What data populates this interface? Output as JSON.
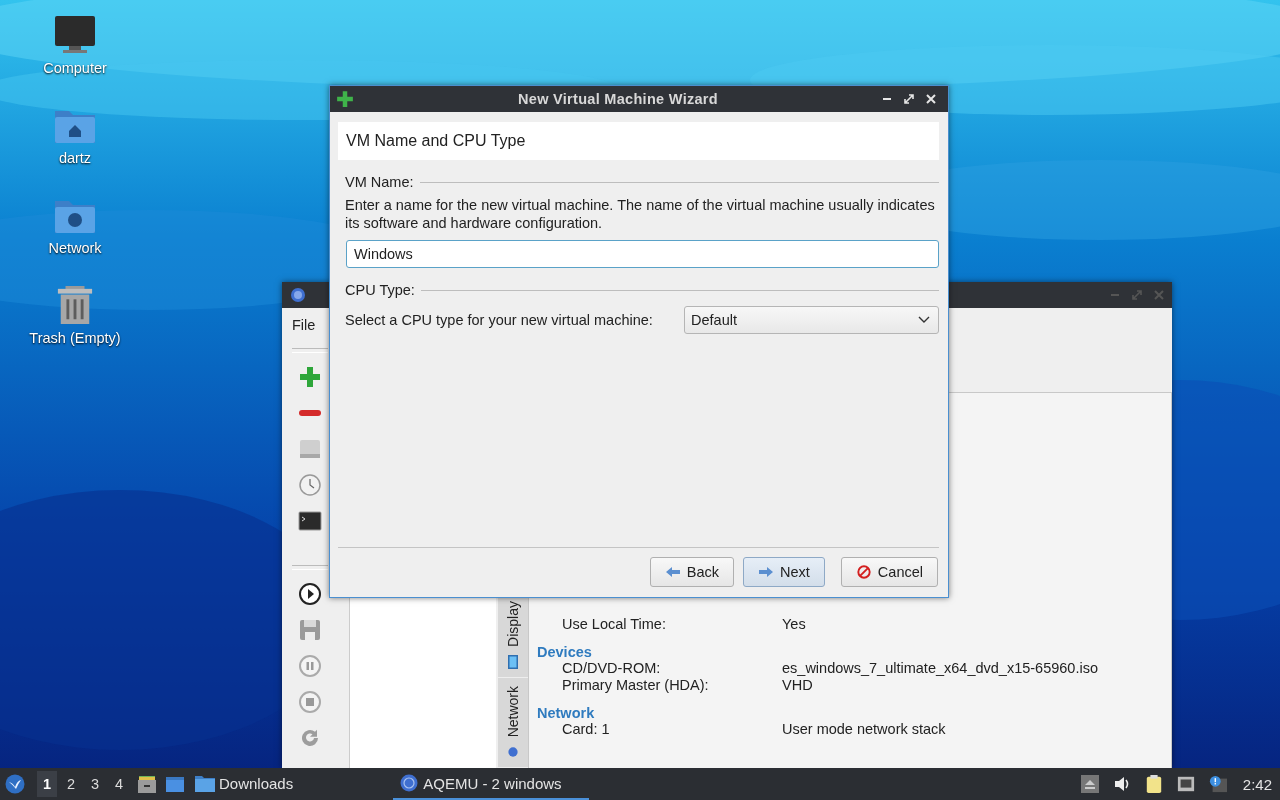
{
  "desktop_icons": [
    {
      "label": "Computer",
      "kind": "computer"
    },
    {
      "label": "dartz",
      "kind": "home"
    },
    {
      "label": "Network",
      "kind": "network"
    },
    {
      "label": "Trash (Empty)",
      "kind": "trash"
    }
  ],
  "back_window": {
    "menu": [
      "File"
    ],
    "side_tabs": [
      {
        "label": "Display",
        "kind": "display"
      },
      {
        "label": "Network",
        "kind": "network"
      }
    ],
    "details": [
      {
        "rows": [
          {
            "label": "Use Local Time:",
            "value": "Yes"
          }
        ]
      },
      {
        "heading": "Devices",
        "rows": [
          {
            "label": "CD/DVD-ROM:",
            "value": "es_windows_7_ultimate_x64_dvd_x15-65960.iso"
          },
          {
            "label": "Primary Master (HDA):",
            "value": "VHD"
          }
        ]
      },
      {
        "heading": "Network",
        "rows": [
          {
            "label": "Card: 1",
            "value": "User mode network stack"
          }
        ]
      }
    ]
  },
  "dialog": {
    "title": "New Virtual Machine Wizard",
    "page_title": "VM Name and CPU Type",
    "vm_name_label": "VM Name:",
    "vm_name_help": "Enter a name for the new virtual machine. The name of the virtual machine usually indicates its software and hardware configuration.",
    "vm_name_value": "Windows",
    "cpu_label": "CPU Type:",
    "cpu_prompt": "Select a CPU type for your new virtual machine:",
    "cpu_value": "Default",
    "buttons": [
      {
        "label": "Back",
        "kind": "back",
        "focused": false
      },
      {
        "label": "Next",
        "kind": "next",
        "focused": true
      },
      {
        "label": "Cancel",
        "kind": "cancel",
        "focused": false
      }
    ]
  },
  "taskbar": {
    "workspaces": [
      {
        "label": "1",
        "selected": true
      },
      {
        "label": "2",
        "selected": false
      },
      {
        "label": "3",
        "selected": false
      },
      {
        "label": "4",
        "selected": false
      }
    ],
    "tasks": [
      {
        "label": "Downloads",
        "kind": "folder",
        "selected": false
      },
      {
        "label": "AQEMU - 2 windows",
        "kind": "app",
        "selected": true
      }
    ],
    "clock": "2:42"
  }
}
